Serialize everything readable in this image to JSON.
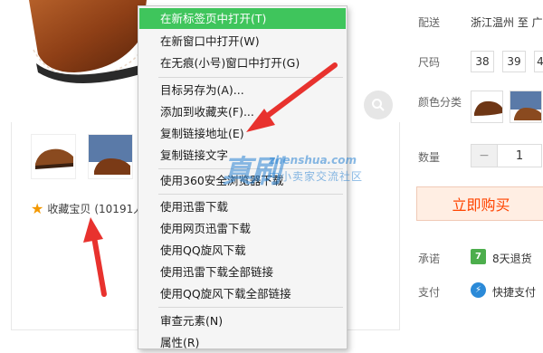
{
  "product": {
    "favorite_label": "收藏宝贝",
    "favorite_count": "(10191人"
  },
  "details": {
    "shipping_label": "配送",
    "shipping_value": "浙江温州 至 广",
    "size_label": "尺码",
    "sizes": [
      "38",
      "39",
      "4"
    ],
    "color_label": "颜色分类",
    "quantity_label": "数量",
    "quantity_minus": "−",
    "quantity_value": "1",
    "buy_label": "立即购买",
    "promise_label": "承诺",
    "promise_icon_text": "7",
    "promise_value": "8天退货",
    "payment_label": "支付",
    "payment_value": "快捷支付"
  },
  "context_menu": {
    "items": [
      "在新标签页中打开(T)",
      "在新窗口中打开(W)",
      "在无痕(小号)窗口中打开(G)",
      "目标另存为(A)...",
      "添加到收藏夹(F)...",
      "复制链接地址(E)",
      "复制链接文字",
      "使用360安全浏览器下载",
      "使用迅雷下载",
      "使用网页迅雷下载",
      "使用QQ旋风下载",
      "使用迅雷下载全部链接",
      "使用QQ旋风下载全部链接",
      "审查元素(N)",
      "属性(R)"
    ],
    "selected_index": 0
  },
  "watermark": {
    "logo": "真刷",
    "url": "zhenshua.com",
    "tagline": "中小卖家交流社区"
  },
  "colors": {
    "menu_highlight": "#3fc55c",
    "buy_text": "#ff4400",
    "arrow": "#e8322e",
    "star": "#f39800"
  }
}
